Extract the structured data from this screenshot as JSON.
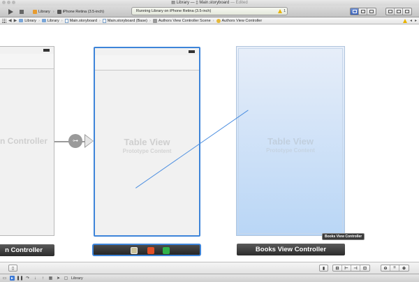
{
  "window": {
    "app": "Library",
    "separator": "—",
    "file": "Main.storyboard",
    "edited": "— Edited"
  },
  "toolbar": {
    "scheme": "Library",
    "device": "iPhone Retina (3.5-inch)",
    "activity": "Running Library on iPhone Retina (3.5-inch)",
    "warning_count": "1"
  },
  "jumpbar": {
    "crumbs": [
      "Library",
      "Library",
      "Main.storyboard",
      "Main.storyboard (Base)",
      "Authors View Controller Scene",
      "Authors View Controller"
    ]
  },
  "canvas": {
    "scene1_title": "n Controller",
    "scene1_label": "n Controller",
    "scene2_title": "Table View",
    "scene2_sub": "Prototype Content",
    "scene3_title": "Table View",
    "scene3_sub": "Prototype Content",
    "scene3_label": "Books View Controller",
    "tooltip": "Books View Controller"
  },
  "debug": {
    "target": "Library"
  },
  "colors": {
    "selection": "#3d84d9",
    "connection": "#4d8fe0"
  }
}
